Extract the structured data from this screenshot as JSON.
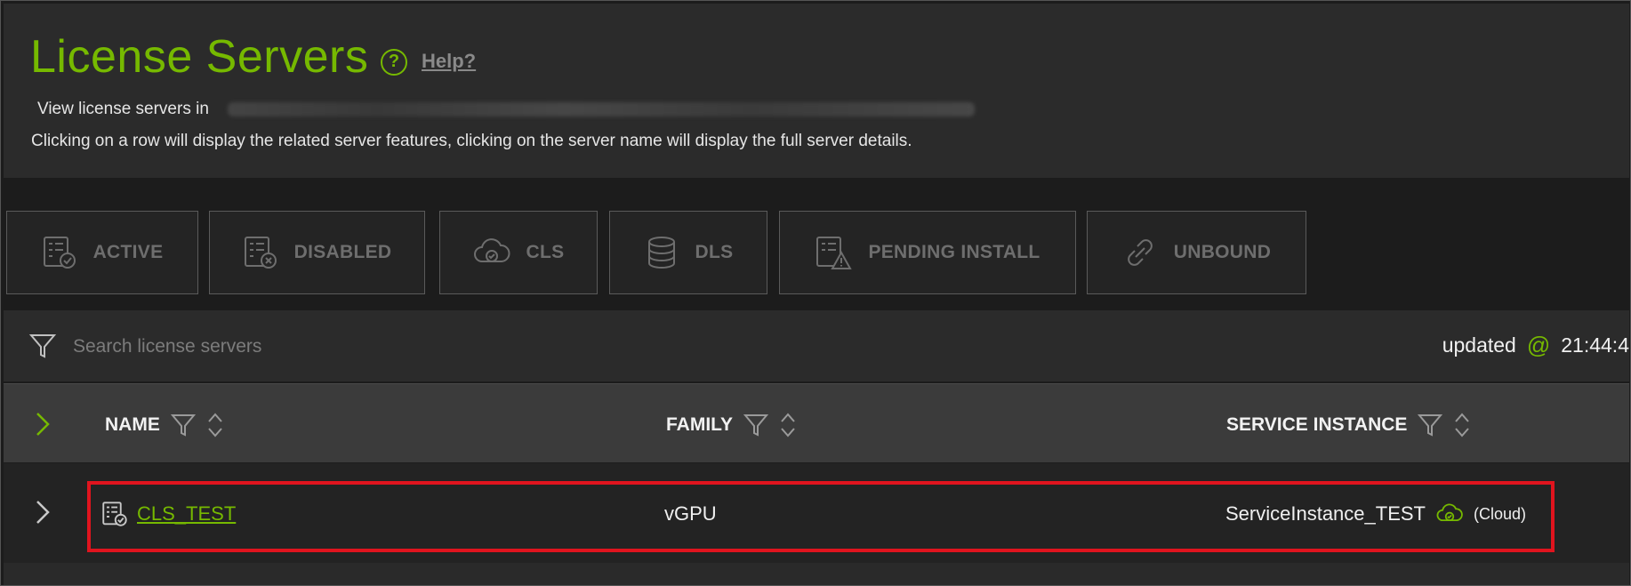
{
  "header": {
    "title": "License Servers",
    "help_link": "Help?",
    "subtitle": "View license servers in",
    "instruction": "Clicking on a row will display the related server features, clicking on the server name will display the full server details."
  },
  "filters": [
    {
      "label": "ACTIVE",
      "icon": "server-check-icon"
    },
    {
      "label": "DISABLED",
      "icon": "server-x-icon"
    },
    {
      "label": "CLS",
      "icon": "cloud-icon"
    },
    {
      "label": "DLS",
      "icon": "database-icon"
    },
    {
      "label": "PENDING INSTALL",
      "icon": "server-warning-icon"
    },
    {
      "label": "UNBOUND",
      "icon": "unlink-icon"
    }
  ],
  "search": {
    "placeholder": "Search license servers",
    "value": ""
  },
  "status": {
    "updated_label": "updated",
    "time": "21:44:4"
  },
  "table": {
    "columns": [
      "NAME",
      "FAMILY",
      "SERVICE INSTANCE"
    ],
    "rows": [
      {
        "name": "CLS_TEST",
        "family": "vGPU",
        "service_instance": "ServiceInstance_TEST",
        "instance_type": "(Cloud)"
      }
    ]
  },
  "colors": {
    "accent": "#76b900",
    "highlight": "#e0141e"
  }
}
